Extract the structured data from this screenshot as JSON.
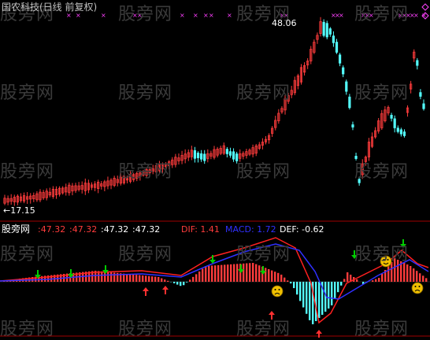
{
  "title": "国农科技(日线 前复权)",
  "watermark": "股旁网",
  "price_high_label": "48.06",
  "price_low_label": "←17.15",
  "indicator": {
    "name": "股旁网",
    "v1": ":47.32",
    "v2": ":47.32",
    "v3": ":47.32",
    "v4": ":47.32",
    "dif": "DIF: 1.41",
    "macd": "MACD: 1.72",
    "def": "DEF: -0.62"
  },
  "colors": {
    "up": "#ff3c3c",
    "down": "#54ffff",
    "dif_line": "#ff2020",
    "macd_line": "#3030ff",
    "arrow_down": "#00cc00",
    "arrow_up": "#ff3030",
    "marker": "#ff40ff",
    "title": "#c0c0c0",
    "border": "#a00000"
  },
  "icons": [
    "smiley-face-icon",
    "sad-face-icon",
    "diamond-up-icon",
    "diamond-down-icon"
  ],
  "chart_data": {
    "type": "candlestick",
    "price_range": [
      17.15,
      48.06
    ],
    "title": "国农科技(日线 前复权)"
  }
}
